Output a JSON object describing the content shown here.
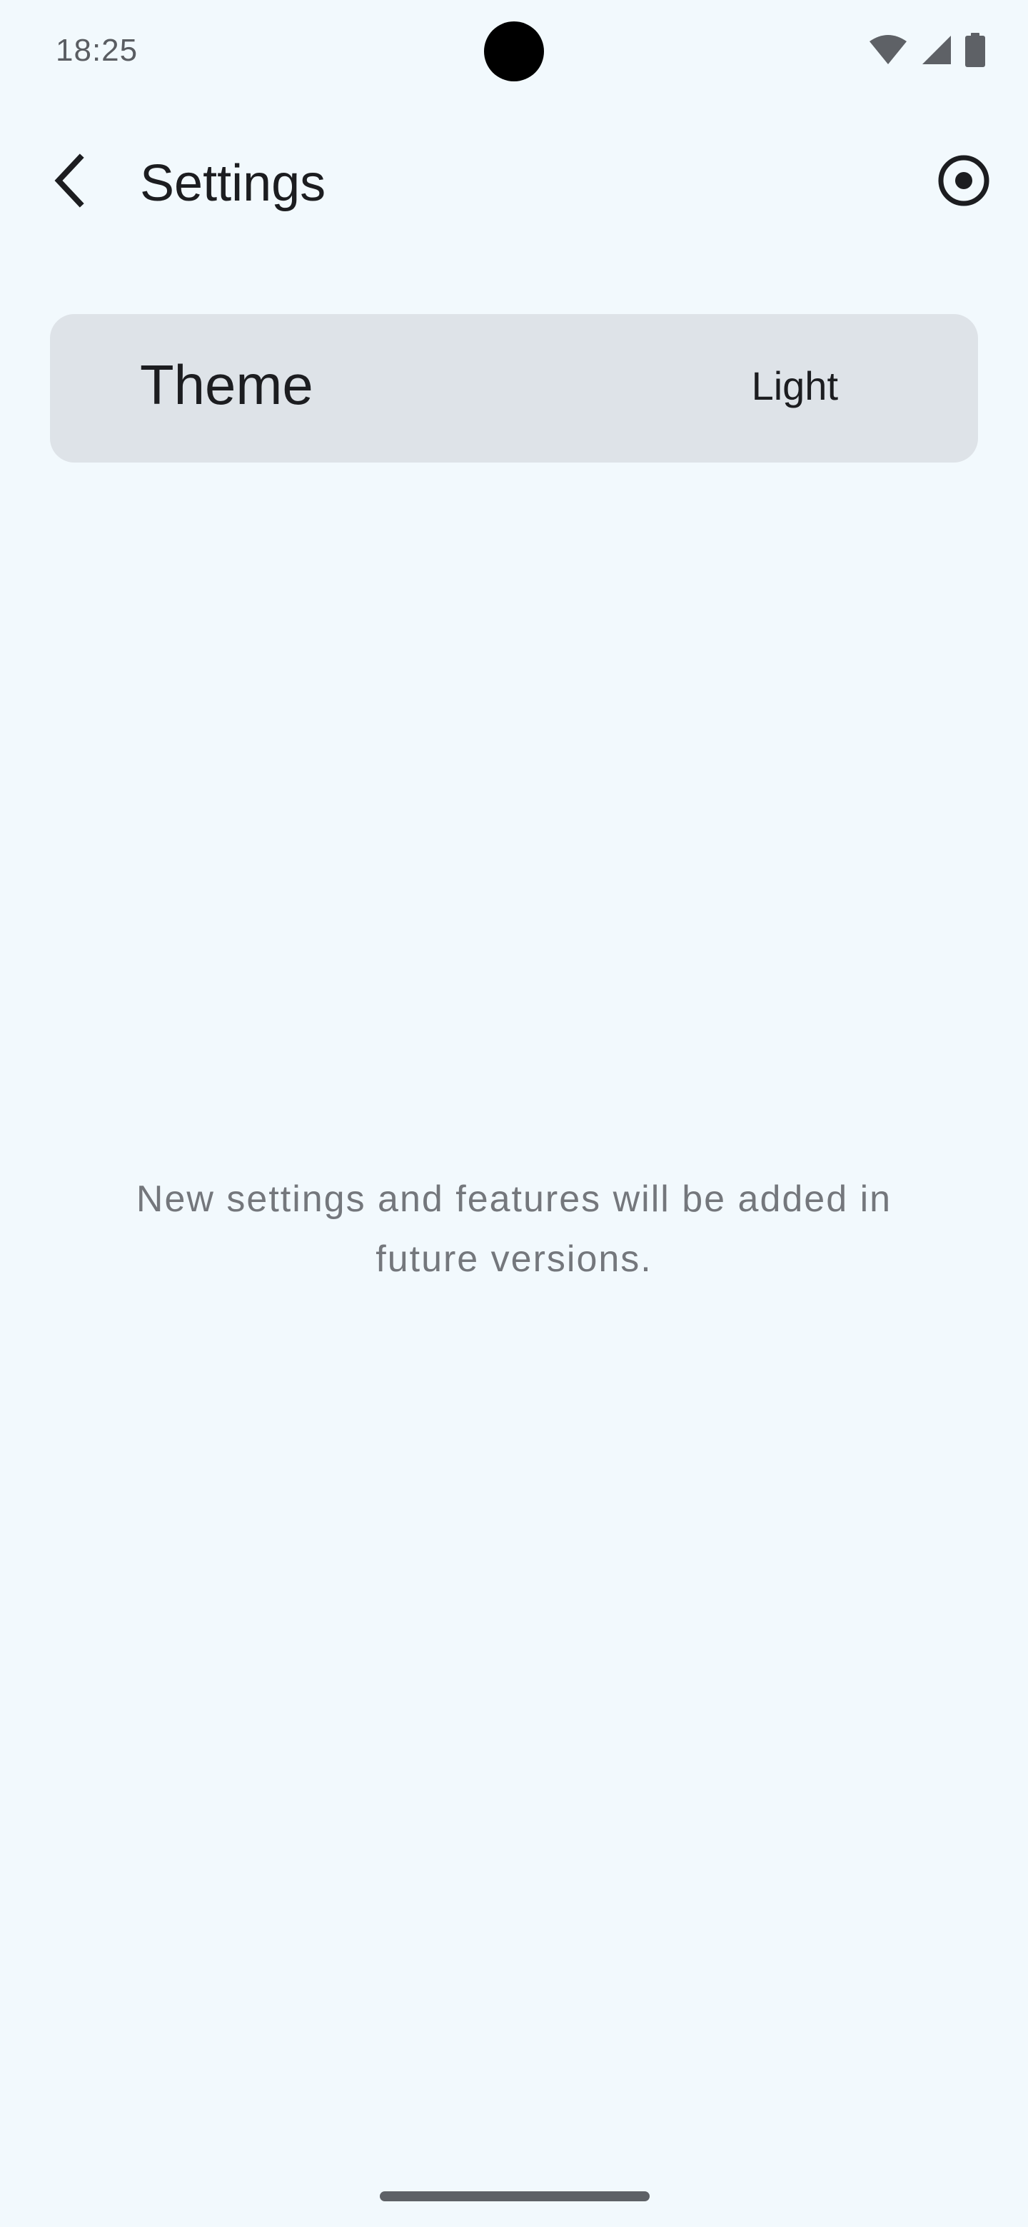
{
  "status_bar": {
    "time": "18:25",
    "icons": [
      "wifi-icon",
      "cell-signal-icon",
      "battery-icon"
    ]
  },
  "app_bar": {
    "title": "Settings",
    "back_icon": "chevron-left-icon",
    "action_icon": "radio-target-icon"
  },
  "settings": {
    "theme": {
      "label": "Theme",
      "value": "Light"
    }
  },
  "info": {
    "message": "New settings and features will be added in future versions."
  },
  "colors": {
    "background": "#f2f9fd",
    "row_background": "#dee3e8",
    "text_primary": "#1c1d20",
    "text_secondary": "#74777c"
  }
}
